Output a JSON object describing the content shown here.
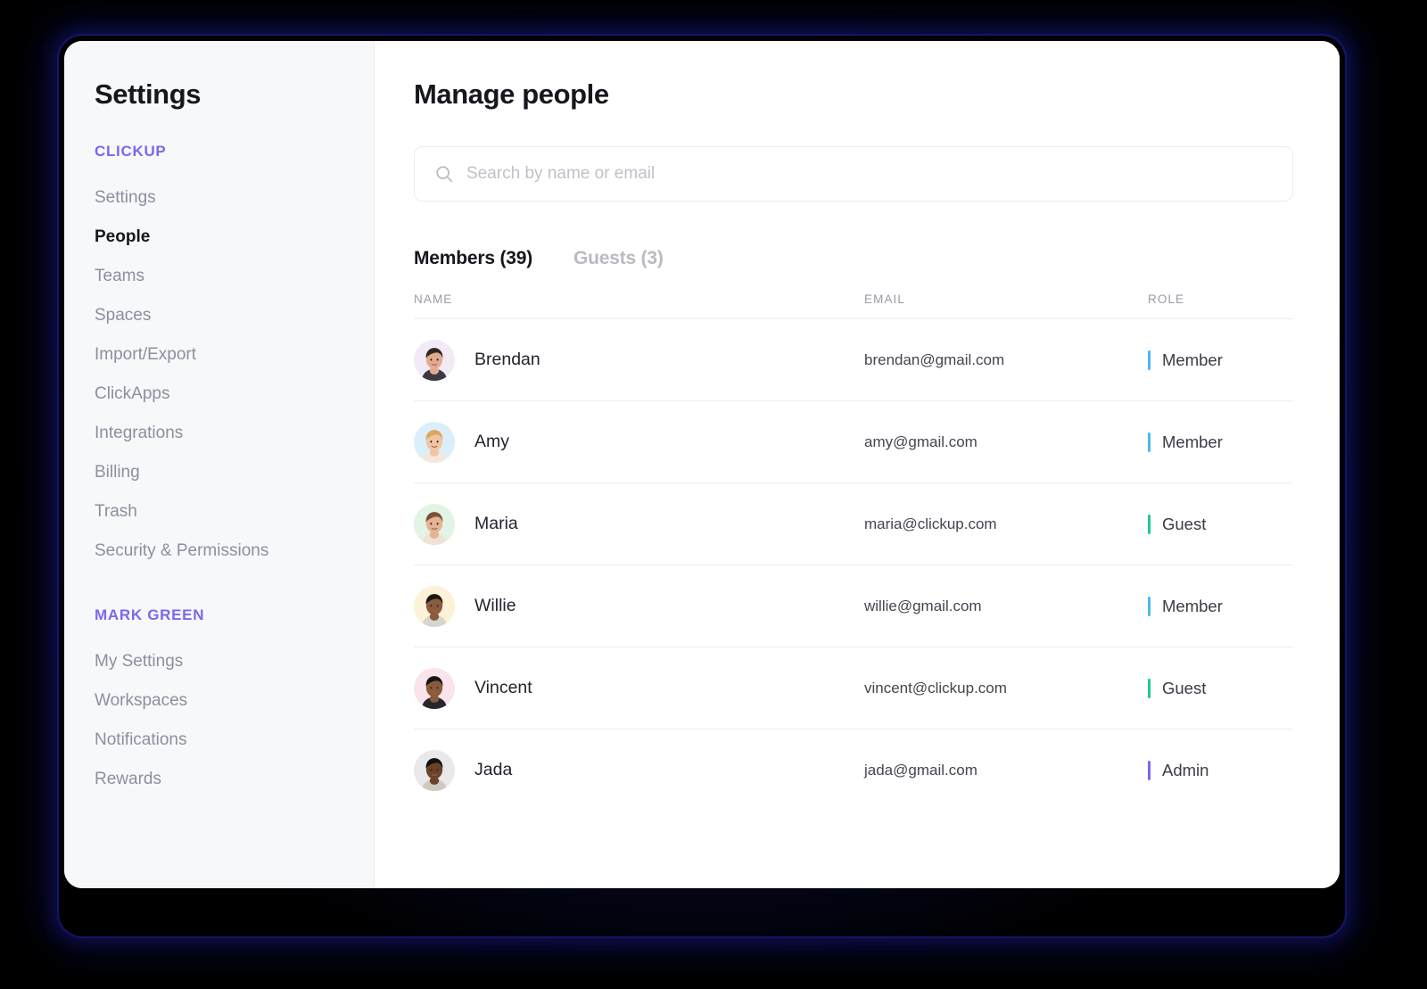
{
  "sidebar": {
    "title": "Settings",
    "groups": [
      {
        "label": "CLICKUP",
        "items": [
          {
            "label": "Settings",
            "active": false
          },
          {
            "label": "People",
            "active": true
          },
          {
            "label": "Teams",
            "active": false
          },
          {
            "label": "Spaces",
            "active": false
          },
          {
            "label": "Import/Export",
            "active": false
          },
          {
            "label": "ClickApps",
            "active": false
          },
          {
            "label": "Integrations",
            "active": false
          },
          {
            "label": "Billing",
            "active": false
          },
          {
            "label": "Trash",
            "active": false
          },
          {
            "label": "Security & Permissions",
            "active": false
          }
        ]
      },
      {
        "label": "MARK GREEN",
        "items": [
          {
            "label": "My Settings",
            "active": false
          },
          {
            "label": "Workspaces",
            "active": false
          },
          {
            "label": "Notifications",
            "active": false
          },
          {
            "label": "Rewards",
            "active": false
          }
        ]
      }
    ]
  },
  "main": {
    "title": "Manage people",
    "search": {
      "placeholder": "Search by name or email",
      "value": "",
      "icon": "search-icon"
    },
    "tabs": [
      {
        "label": "Members (39)",
        "active": true
      },
      {
        "label": "Guests (3)",
        "active": false
      }
    ],
    "table": {
      "columns": [
        "NAME",
        "EMAIL",
        "ROLE"
      ],
      "rows": [
        {
          "name": "Brendan",
          "email": "brendan@gmail.com",
          "role": "Member",
          "role_color": "#4bb8f0",
          "avatar_bg": "#f2eaf6",
          "skin": "#e2ab8f",
          "hair": "#2f2723",
          "shirt": "#3c3a40"
        },
        {
          "name": "Amy",
          "email": "amy@gmail.com",
          "role": "Member",
          "role_color": "#4bb8f0",
          "avatar_bg": "#dceefa",
          "skin": "#f0c5a6",
          "hair": "#d9a85f",
          "shirt": "#f3e8de"
        },
        {
          "name": "Maria",
          "email": "maria@clickup.com",
          "role": "Guest",
          "role_color": "#20c997",
          "avatar_bg": "#e2f4e4",
          "skin": "#e6b394",
          "hair": "#7a5236",
          "shirt": "#efe2d6"
        },
        {
          "name": "Willie",
          "email": "willie@gmail.com",
          "role": "Member",
          "role_color": "#4bb8f0",
          "avatar_bg": "#fbf2d8",
          "skin": "#8a5b3c",
          "hair": "#1d1714",
          "shirt": "#d8d5cf"
        },
        {
          "name": "Vincent",
          "email": "vincent@clickup.com",
          "role": "Guest",
          "role_color": "#20c997",
          "avatar_bg": "#fae4ec",
          "skin": "#8a5b3c",
          "hair": "#181312",
          "shirt": "#2a2630"
        },
        {
          "name": "Jada",
          "email": "jada@gmail.com",
          "role": "Admin",
          "role_color": "#7b68ee",
          "avatar_bg": "#e9e9ec",
          "skin": "#6b422b",
          "hair": "#14100f",
          "shirt": "#cfc9c2"
        }
      ]
    }
  },
  "colors": {
    "accent_purple": "#7b68ee",
    "role_member": "#4bb8f0",
    "role_guest": "#20c997",
    "role_admin": "#7b68ee",
    "sidebar_bg": "#f7f8fa",
    "page_bg": "#000000"
  }
}
